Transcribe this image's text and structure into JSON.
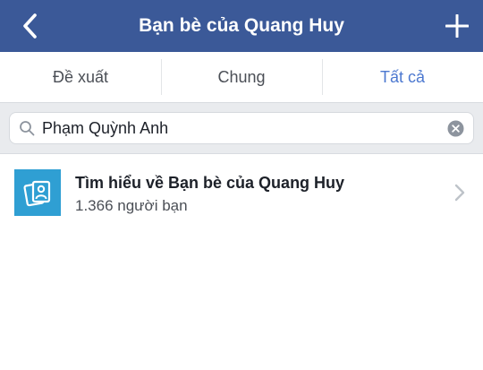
{
  "header": {
    "title": "Bạn bè của Quang Huy",
    "back_icon": "chevron-left-icon",
    "add_icon": "plus-icon",
    "background_color": "#3b5998"
  },
  "tabs": [
    {
      "label": "Đề xuất",
      "active": false
    },
    {
      "label": "Chung",
      "active": false
    },
    {
      "label": "Tất cả",
      "active": true
    }
  ],
  "search": {
    "value": "Phạm Quỳnh Anh",
    "icon": "search-icon",
    "clear_icon": "clear-icon"
  },
  "results": [
    {
      "title": "Tìm hiểu về Bạn bè của Quang Huy",
      "subtitle": "1.366 người bạn",
      "icon": "friends-photos-icon",
      "icon_background": "#2f9fd3",
      "trailing_icon": "chevron-right-icon"
    }
  ],
  "colors": {
    "accent": "#4c78d0",
    "header": "#3b5998"
  }
}
